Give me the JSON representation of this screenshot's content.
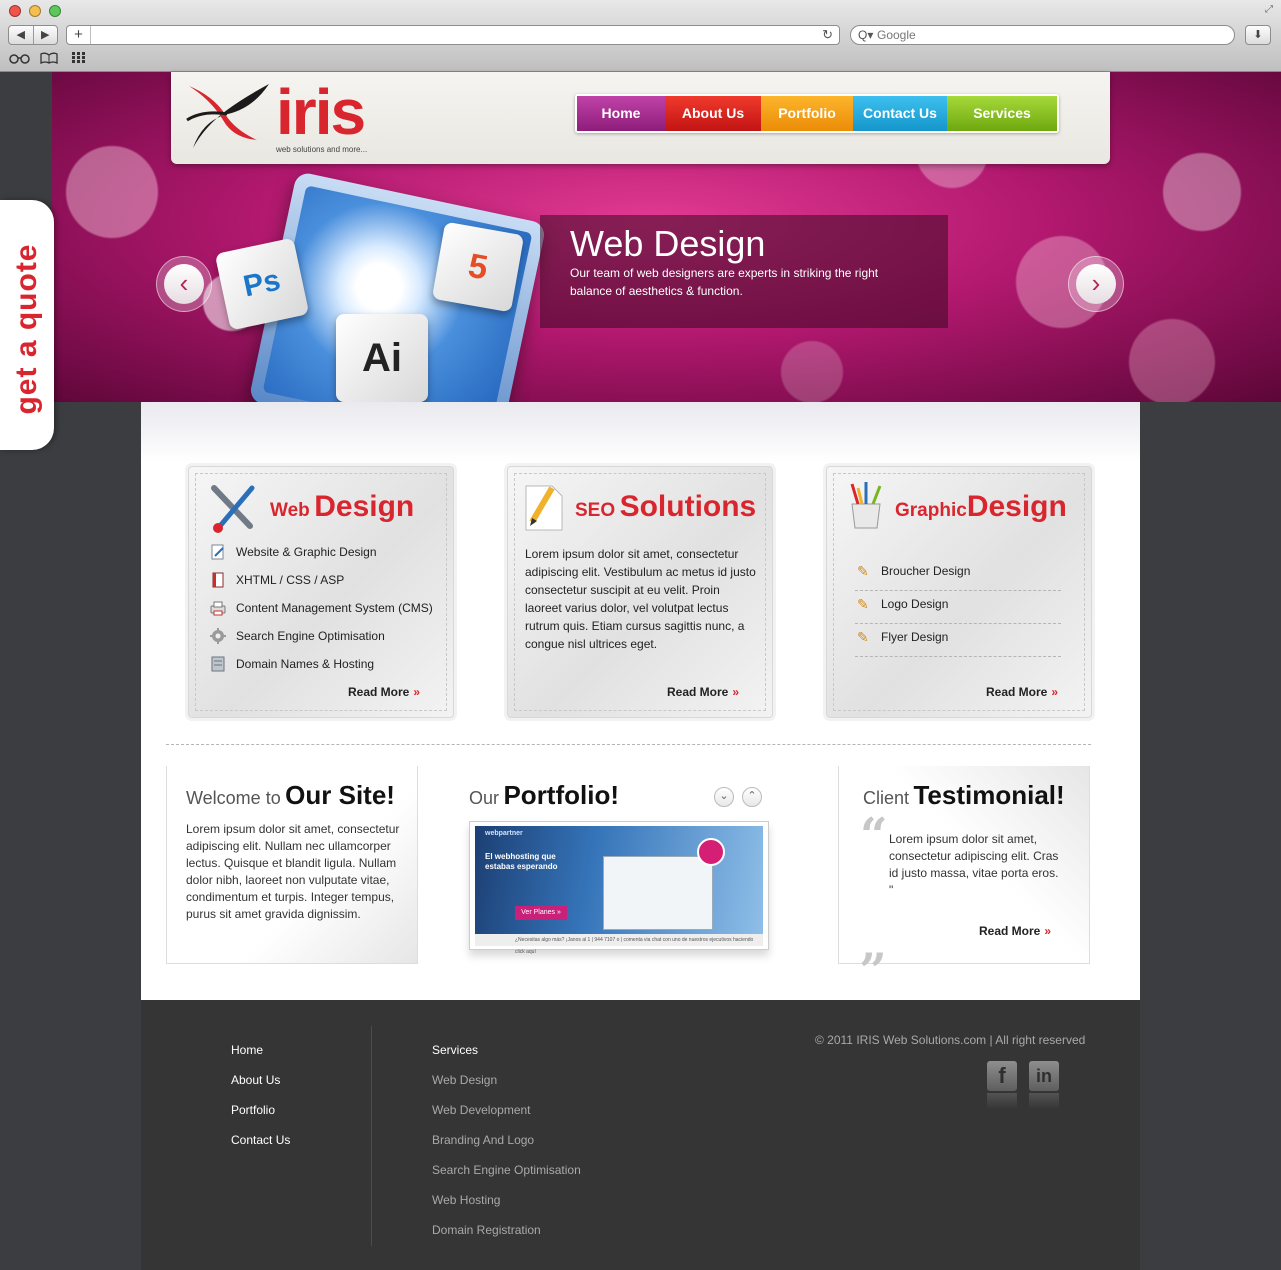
{
  "browser": {
    "search_placeholder": "Google",
    "back_glyph": "◀",
    "forward_glyph": "▶",
    "new_tab_glyph": "+",
    "reload_glyph": "↻",
    "search_glyph": "Q▾",
    "download_glyph": "⬇",
    "resize_glyph": "⤢",
    "bookmark_icons": [
      "reading-glasses-icon",
      "book-icon",
      "grid-icon"
    ]
  },
  "header": {
    "logo_text": "iris",
    "logo_tagline": "web solutions and more...",
    "nav": [
      {
        "label": "Home",
        "color": "#a6278f"
      },
      {
        "label": "About Us",
        "color": "#dd2020"
      },
      {
        "label": "Portfolio",
        "color": "#f7a312"
      },
      {
        "label": "Contact Us",
        "color": "#1eaadf"
      },
      {
        "label": "Services",
        "color": "#88c21a"
      }
    ]
  },
  "quote_tab": {
    "label": "get a quote"
  },
  "slider": {
    "title": "Web Design",
    "text": "Our team of web designers are experts in striking the right balance of aesthetics & function.",
    "prev_glyph": "‹",
    "next_glyph": "›",
    "cubes": [
      "Ps",
      "Ai",
      "5"
    ]
  },
  "services": {
    "web": {
      "title_small": "Web",
      "title_big": "Design",
      "items": [
        "Website & Graphic Design",
        "XHTML / CSS / ASP",
        "Content Management System (CMS)",
        "Search Engine Optimisation",
        "Domain Names & Hosting"
      ],
      "read_more": "Read More"
    },
    "seo": {
      "title_small": "SEO",
      "title_big": "Solutions",
      "text": "Lorem ipsum dolor sit amet, consectetur adipiscing elit. Vestibulum ac metus id justo consectetur suscipit at eu velit. Proin laoreet varius dolor, vel volutpat lectus rutrum quis. Etiam cursus sagittis nunc, a congue nisl ultrices eget.",
      "read_more": "Read More"
    },
    "graphic": {
      "title_small": "Graphic",
      "title_big": "Design",
      "items": [
        "Broucher Design",
        "Logo Design",
        "Flyer Design"
      ],
      "read_more": "Read More"
    },
    "read_more_glyph": "»"
  },
  "welcome": {
    "title_light": "Welcome to",
    "title_bold": "Our Site!",
    "text": "Lorem ipsum dolor sit amet, consectetur adipiscing elit. Nullam nec ullamcorper lectus. Quisque et blandit ligula. Nullam dolor nibh, laoreet non vulputate vitae, condimentum et turpis. Integer tempus, purus sit amet gravida dignissim."
  },
  "portfolio": {
    "title_light": "Our",
    "title_bold": "Portfolio!",
    "down_glyph": "⌄",
    "up_glyph": "⌃",
    "shot_brand": "webpartner",
    "shot_headline": "El webhosting que estabas esperando",
    "shot_button": "Ver Planes »",
    "shot_footer": "¿Necesitas algo más? ¡Janos al 1 | 944 7107 o | comenta via chat con uno de nuestros ejecutivos haciendo click aquí"
  },
  "testimonial": {
    "title_light": "Client",
    "title_bold": "Testimonial!",
    "text": "Lorem ipsum dolor sit amet, consectetur adipiscing elit. Cras id justo massa, vitae porta eros. \"",
    "open_quote": "“",
    "close_quote": "„",
    "read_more": "Read More"
  },
  "footer": {
    "col1": [
      "Home",
      "About Us",
      "Portfolio",
      "Contact Us"
    ],
    "col2_heading": "Services",
    "col2": [
      "Web Design",
      "Web Development",
      "Branding And Logo",
      "Search Engine Optimisation",
      "Web Hosting",
      "Domain Registration"
    ],
    "copyright": "© 2011 IRIS Web Solutions.com | All right reserved",
    "social": [
      {
        "icon": "facebook-icon",
        "glyph": "f"
      },
      {
        "icon": "linkedin-icon",
        "glyph": "in"
      }
    ]
  }
}
